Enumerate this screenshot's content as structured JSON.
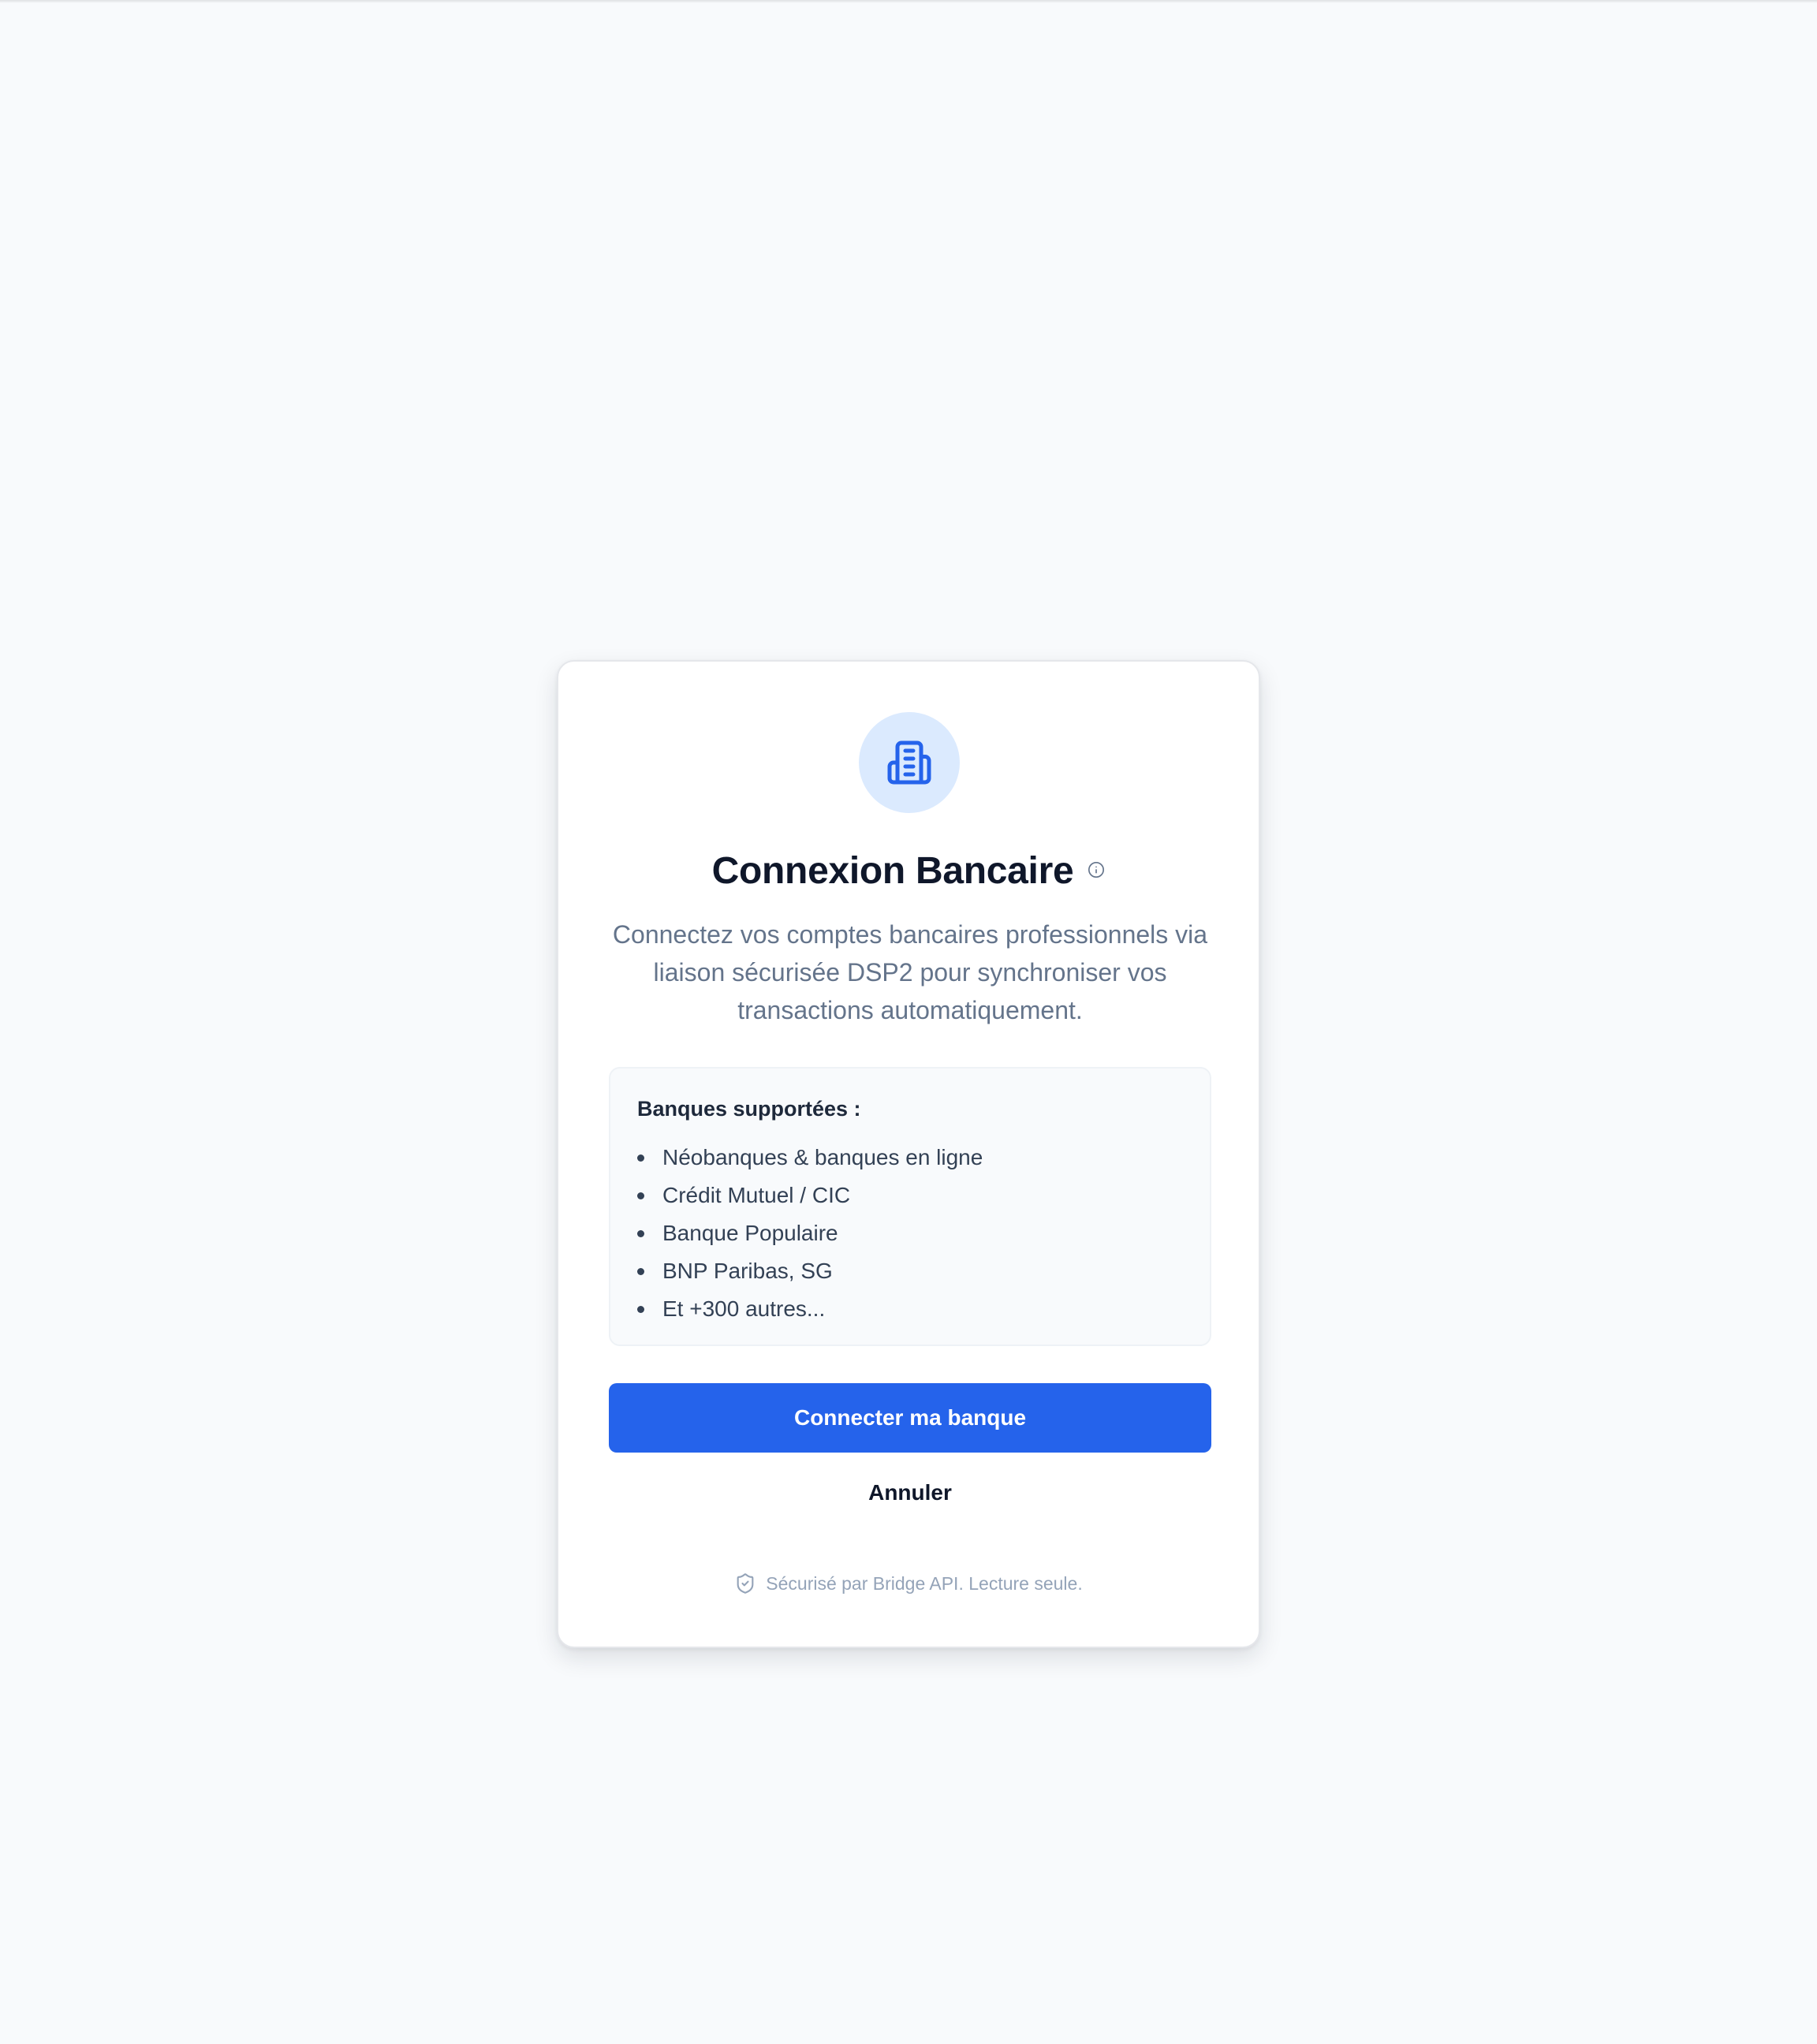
{
  "dialog": {
    "title": "Connexion Bancaire",
    "description": "Connectez vos comptes bancaires professionnels via liaison sécurisée DSP2 pour synchroniser vos transactions automatiquement.",
    "icon": "bank-building-icon",
    "info_icon": "info-icon"
  },
  "banks": {
    "heading": "Banques supportées :",
    "items": [
      "Néobanques & banques en ligne",
      "Crédit Mutuel / CIC",
      "Banque Populaire",
      "BNP Paribas, SG",
      "Et +300 autres..."
    ]
  },
  "actions": {
    "connect_label": "Connecter ma banque",
    "cancel_label": "Annuler"
  },
  "footer": {
    "secure_text": "Sécurisé par Bridge API. Lecture seule.",
    "icon": "shield-check-icon"
  },
  "colors": {
    "primary": "#2563eb",
    "icon_bg": "#dbeafe",
    "background": "#f8fafc"
  }
}
